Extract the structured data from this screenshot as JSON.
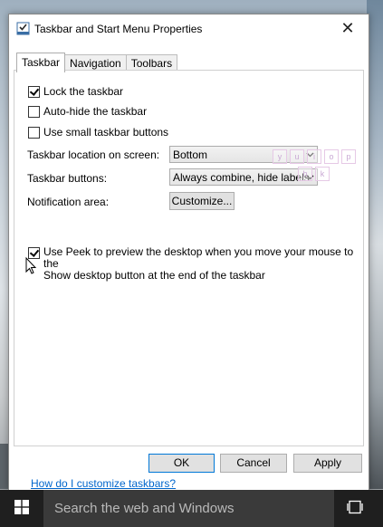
{
  "window": {
    "title": "Taskbar and Start Menu Properties",
    "close_glyph": "✕"
  },
  "tabs": [
    {
      "label": "Taskbar",
      "active": true
    },
    {
      "label": "Navigation",
      "active": false
    },
    {
      "label": "Toolbars",
      "active": false
    }
  ],
  "taskbar_tab": {
    "lock": {
      "label": "Lock the taskbar",
      "checked": true
    },
    "autohide": {
      "label": "Auto-hide the taskbar",
      "checked": false
    },
    "small_buttons": {
      "label": "Use small taskbar buttons",
      "checked": false
    },
    "location_label": "Taskbar location on screen:",
    "location_value": "Bottom",
    "buttons_label": "Taskbar buttons:",
    "buttons_value": "Always combine, hide labels",
    "notification_label": "Notification area:",
    "customize_label": "Customize...",
    "peek_line1": "Use Peek to preview the desktop when you move your mouse to the",
    "peek_line2": "Show desktop button at the end of the taskbar",
    "peek_checked": true,
    "help_link": "How do I customize taskbars?"
  },
  "ghost_keys": [
    "y",
    "u",
    "i",
    "o",
    "p",
    "h",
    "k"
  ],
  "footer": {
    "ok": "OK",
    "cancel": "Cancel",
    "apply": "Apply"
  },
  "os_taskbar": {
    "search_placeholder": "Search the web and Windows"
  },
  "colors": {
    "accent": "#0078d7",
    "link": "#0066cc",
    "taskbar_bg": "#1f1f1f",
    "search_bg": "#3a3a3a"
  }
}
